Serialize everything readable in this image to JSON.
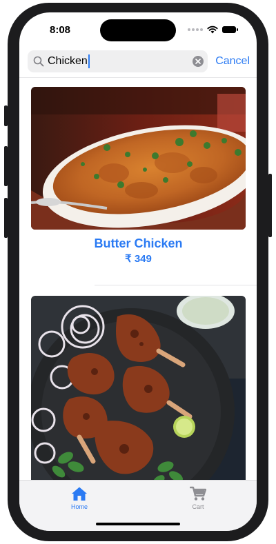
{
  "status_bar": {
    "time": "8:08"
  },
  "search": {
    "query": "Chicken",
    "cancel_label": "Cancel"
  },
  "items": [
    {
      "title": "Butter Chicken",
      "price": "₹ 349"
    },
    {
      "title": "",
      "price": ""
    }
  ],
  "tab_bar": {
    "tabs": [
      {
        "label": "Home",
        "icon": "house-icon",
        "selected": true
      },
      {
        "label": "Cart",
        "icon": "cart-icon",
        "selected": false
      }
    ]
  },
  "colors": {
    "accent": "#2a7af3",
    "tab_inactive": "#8e8e93",
    "search_bg": "#efeff0"
  }
}
